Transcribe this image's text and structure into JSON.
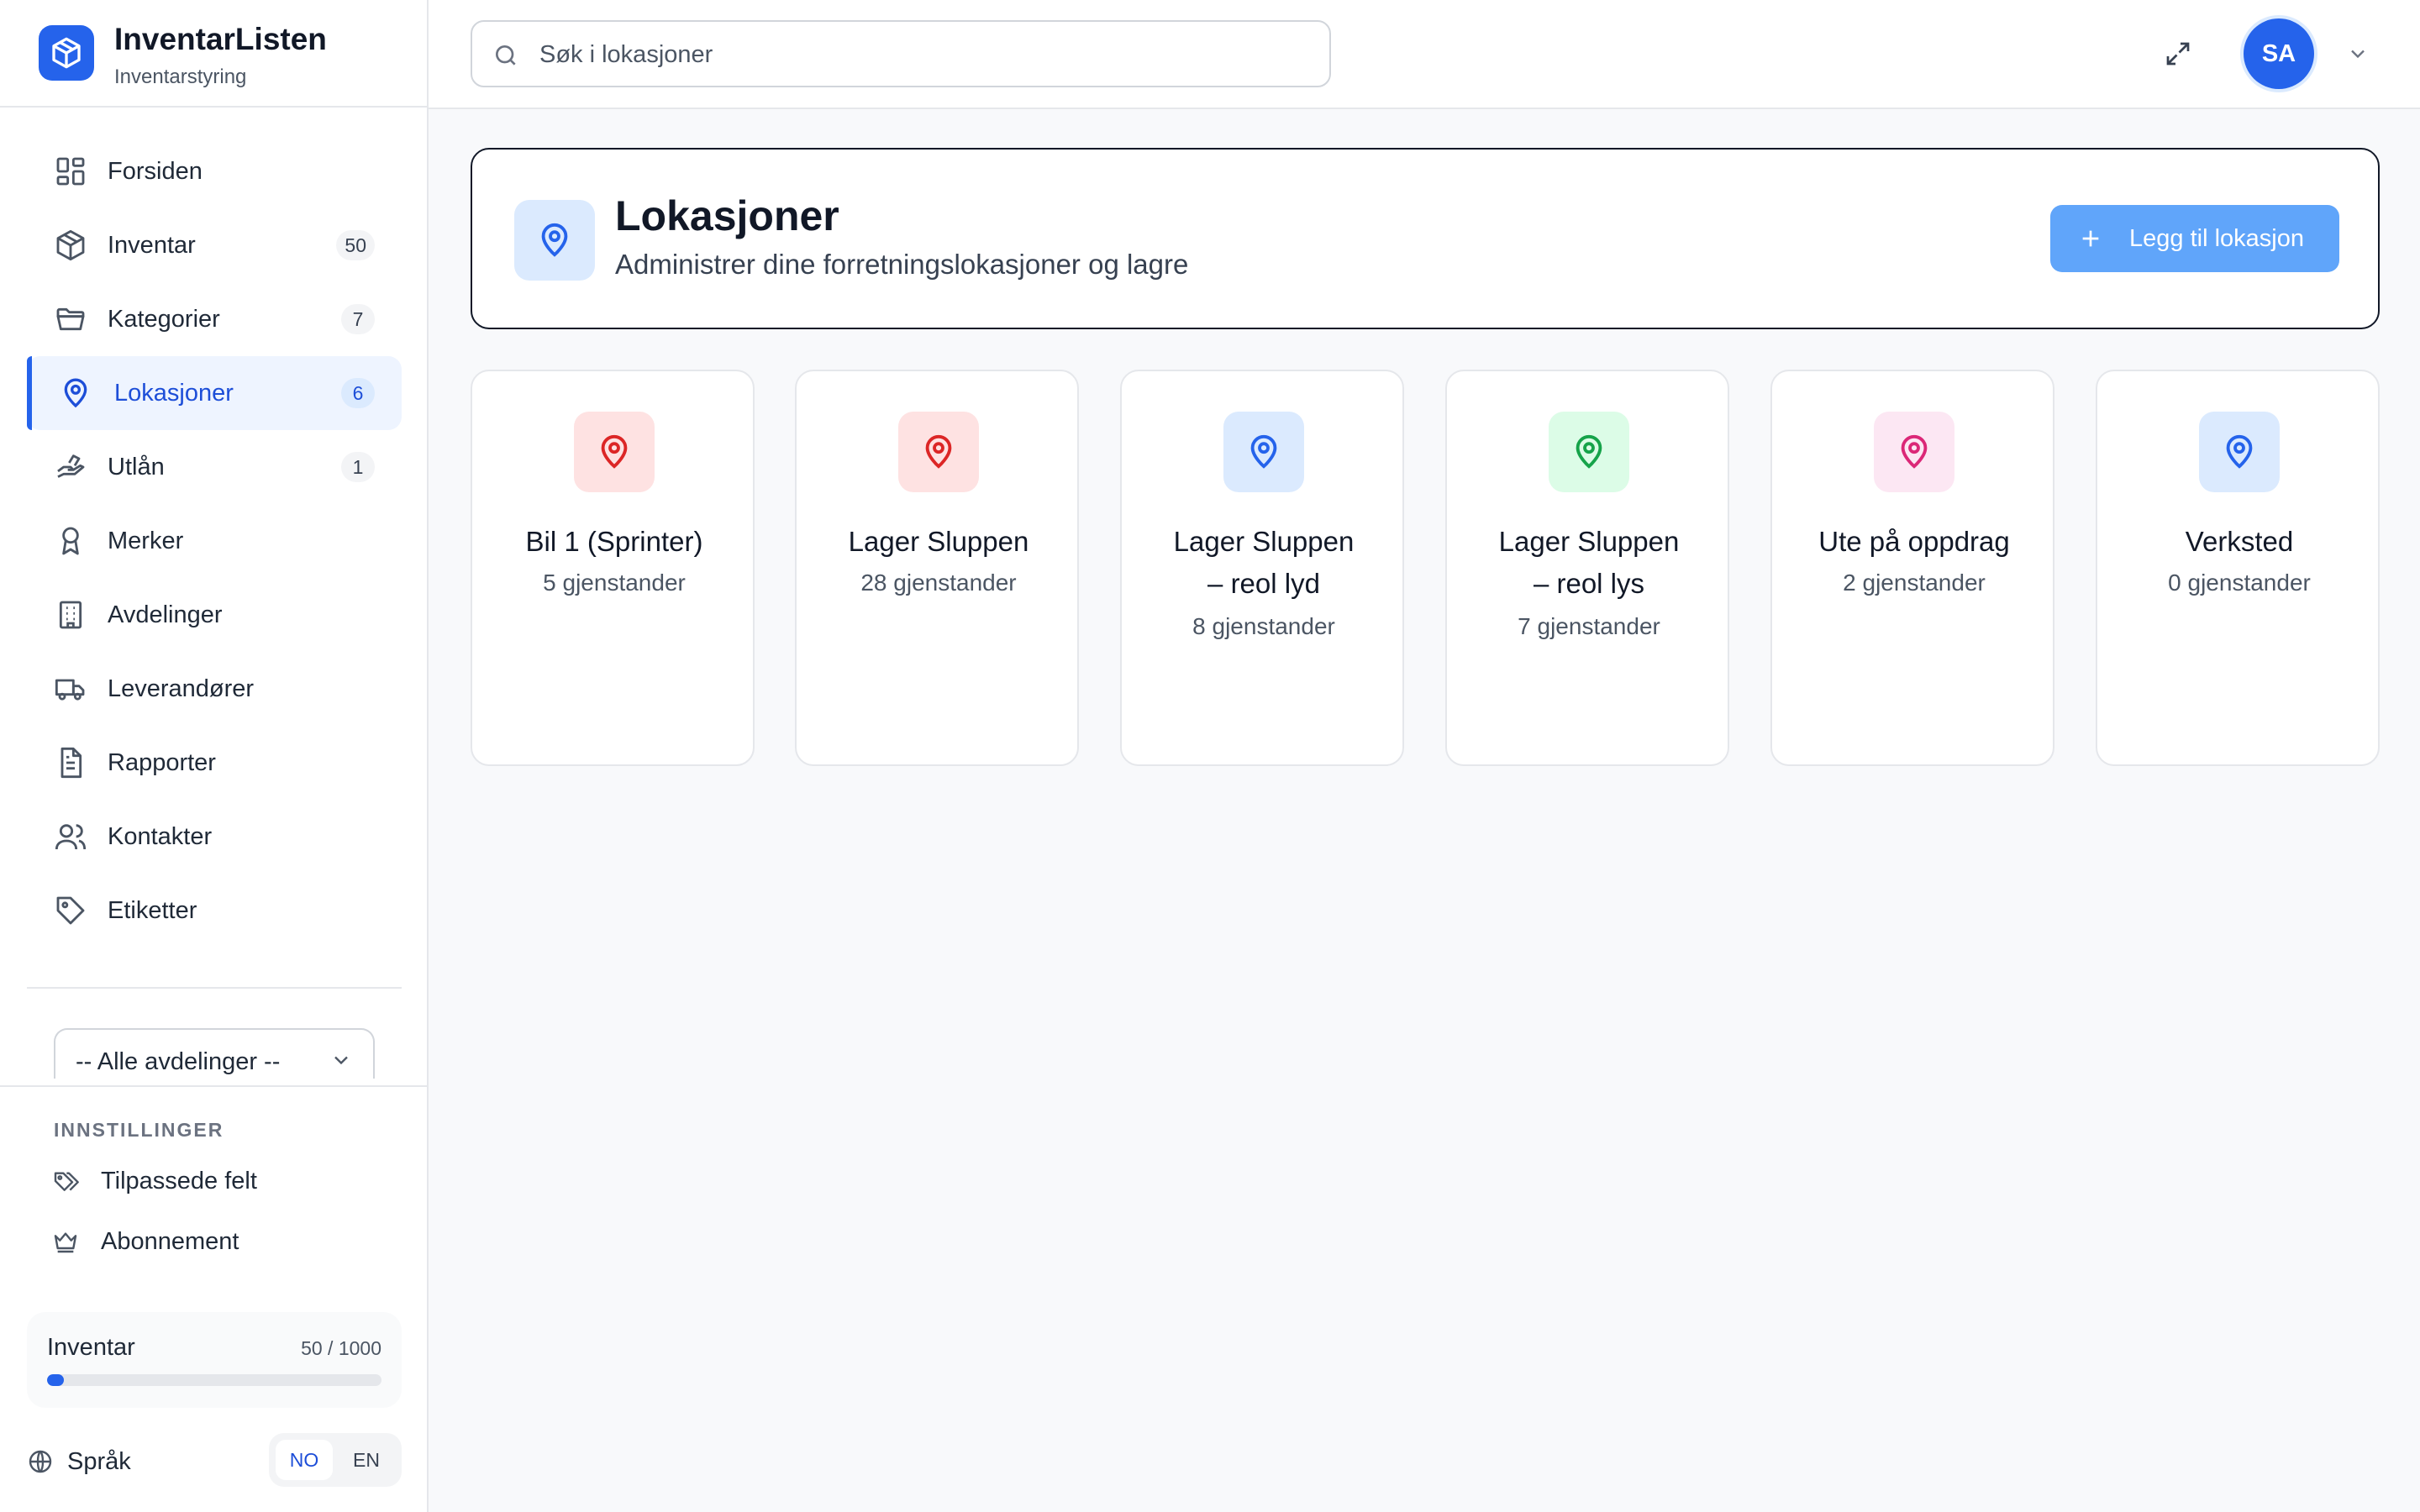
{
  "app": {
    "name": "InventarListen",
    "subtitle": "Inventarstyring"
  },
  "sidebar": {
    "items": [
      {
        "label": "Forsiden",
        "icon": "grid-icon"
      },
      {
        "label": "Inventar",
        "icon": "box-icon",
        "badge": "50"
      },
      {
        "label": "Kategorier",
        "icon": "folder-icon",
        "badge": "7"
      },
      {
        "label": "Lokasjoner",
        "icon": "map-pin-icon",
        "badge": "6",
        "active": true
      },
      {
        "label": "Utlån",
        "icon": "hand-icon",
        "badge": "1"
      },
      {
        "label": "Merker",
        "icon": "award-icon"
      },
      {
        "label": "Avdelinger",
        "icon": "building-icon"
      },
      {
        "label": "Leverandører",
        "icon": "truck-icon"
      },
      {
        "label": "Rapporter",
        "icon": "file-text-icon"
      },
      {
        "label": "Kontakter",
        "icon": "users-icon"
      },
      {
        "label": "Etiketter",
        "icon": "tag-icon"
      }
    ],
    "department_select": {
      "selected": "-- Alle avdelinger --"
    },
    "settings": {
      "heading": "INNSTILLINGER",
      "items": [
        {
          "label": "Tilpassede felt",
          "icon": "tags-icon"
        },
        {
          "label": "Abonnement",
          "icon": "crown-icon"
        }
      ]
    },
    "usage": {
      "label": "Inventar",
      "count_text": "50 / 1000",
      "used": 50,
      "limit": 1000
    },
    "language": {
      "label": "Språk",
      "options": [
        "NO",
        "EN"
      ],
      "selected": "NO"
    }
  },
  "topbar": {
    "search_placeholder": "Søk i lokasjoner",
    "avatar_initials": "SA"
  },
  "header": {
    "title": "Lokasjoner",
    "subtitle": "Administrer dine forretningslokasjoner og lagre",
    "add_button": "Legg til lokasjon"
  },
  "locations": [
    {
      "name_lines": [
        "Bil 1 (Sprinter)"
      ],
      "count": "5 gjenstander",
      "color": "#dc2626",
      "bg": "#fee2e2"
    },
    {
      "name_lines": [
        "Lager Sluppen"
      ],
      "count": "28 gjenstander",
      "color": "#dc2626",
      "bg": "#fee2e2"
    },
    {
      "name_lines": [
        "Lager Sluppen",
        "– reol lyd"
      ],
      "count": "8 gjenstander",
      "color": "#2563eb",
      "bg": "#dbeafe"
    },
    {
      "name_lines": [
        "Lager Sluppen",
        "– reol lys"
      ],
      "count": "7 gjenstander",
      "color": "#16a34a",
      "bg": "#dcfce7"
    },
    {
      "name_lines": [
        "Ute på oppdrag"
      ],
      "count": "2 gjenstander",
      "color": "#db2777",
      "bg": "#fce7f3"
    },
    {
      "name_lines": [
        "Verksted"
      ],
      "count": "0 gjenstander",
      "color": "#2563eb",
      "bg": "#dbeafe"
    }
  ],
  "colors": {
    "accent": "#2563eb",
    "button": "#60a5fa"
  }
}
